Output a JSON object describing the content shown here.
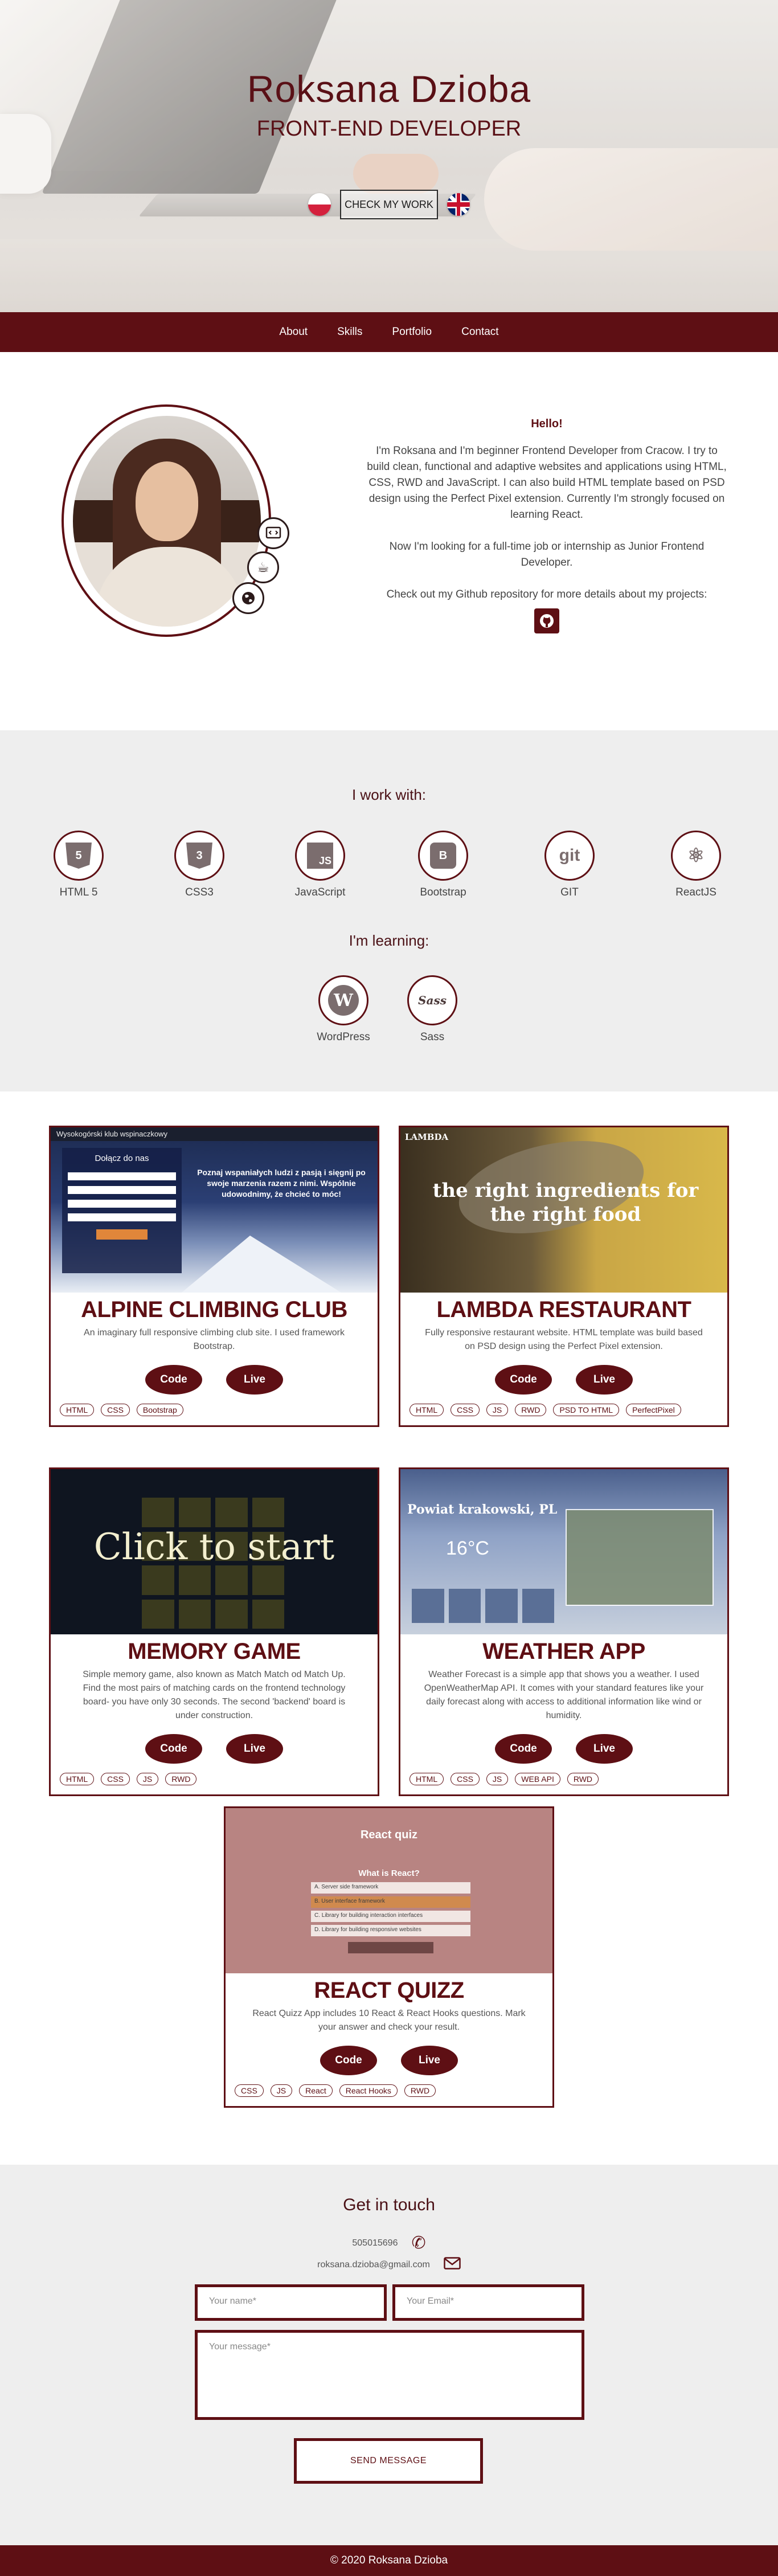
{
  "header": {
    "name": "Roksana Dzioba",
    "role": "FRONT-END DEVELOPER",
    "cta": "CHECK MY WORK"
  },
  "nav": {
    "items": [
      "About",
      "Skills",
      "Portfolio",
      "Contact"
    ]
  },
  "about": {
    "greeting": "Hello!",
    "p1": "I'm Roksana and I'm beginner Frontend Developer from Cracow. I try to build clean, functional and adaptive websites and applications using HTML, CSS, RWD and JavaScript. I can also build HTML template based on PSD design using the Perfect Pixel extension. Currently I'm strongly focused on learning React.",
    "p2": "Now I'm looking for a full-time job or internship as Junior Frontend Developer.",
    "p3": "Check out my Github repository for more details about my projects:"
  },
  "skills": {
    "working_title": "I work with:",
    "working": [
      {
        "label": "HTML 5",
        "icon": "html5-icon",
        "glyph": "5"
      },
      {
        "label": "CSS3",
        "icon": "css3-icon",
        "glyph": "3"
      },
      {
        "label": "JavaScript",
        "icon": "javascript-icon",
        "glyph": "JS"
      },
      {
        "label": "Bootstrap",
        "icon": "bootstrap-icon",
        "glyph": "B"
      },
      {
        "label": "GIT",
        "icon": "git-icon",
        "glyph": "git"
      },
      {
        "label": "ReactJS",
        "icon": "react-icon",
        "glyph": "⚛"
      }
    ],
    "learning_title": "I'm learning:",
    "learning": [
      {
        "label": "WordPress",
        "icon": "wordpress-icon",
        "glyph": "W"
      },
      {
        "label": "Sass",
        "icon": "sass-icon",
        "glyph": "Sass"
      }
    ]
  },
  "projects": [
    {
      "title": "ALPINE CLIMBING CLUB",
      "desc": "An imaginary full responsive climbing club site. I used framework Bootstrap.",
      "code": "Code",
      "live": "Live",
      "tags": [
        "HTML",
        "CSS",
        "Bootstrap"
      ],
      "thumb": {
        "site": "Wysokogórski klub wspinaczkowy",
        "join": "Dołącz do nas",
        "quote": "Poznaj wspaniałych ludzi z pasją i sięgnij po swoje marzenia razem z nimi. Wspólnie udowodnimy, że chcieć to móc!"
      }
    },
    {
      "title": "LAMBDA RESTAURANT",
      "desc": "Fully responsive restaurant website. HTML template was build based on PSD design using the Perfect Pixel extension.",
      "code": "Code",
      "live": "Live",
      "tags": [
        "HTML",
        "CSS",
        "JS",
        "RWD",
        "PSD TO HTML",
        "PerfectPixel"
      ],
      "thumb": {
        "brand": "LAMBDA",
        "headline": "the right ingredients for the right food"
      }
    },
    {
      "title": "MEMORY GAME",
      "desc": "Simple memory game, also known as Match Match od Match Up. Find the most pairs of matching cards on the frontend technology board- you have only 30 seconds. The second 'backend' board is under construction.",
      "code": "Code",
      "live": "Live",
      "tags": [
        "HTML",
        "CSS",
        "JS",
        "RWD"
      ],
      "thumb": {
        "overlay": "Click to start"
      }
    },
    {
      "title": "WEATHER APP",
      "desc": "Weather Forecast is a simple app that shows you a weather. I used OpenWeatherMap API. It comes with your standard features like your daily forecast along with access to additional information like wind or humidity.",
      "code": "Code",
      "live": "Live",
      "tags": [
        "HTML",
        "CSS",
        "JS",
        "WEB API",
        "RWD"
      ],
      "thumb": {
        "city": "Powiat krakowski, PL",
        "temp": "16°C"
      }
    },
    {
      "title": "REACT QUIZZ",
      "desc": "React Quizz App includes 10 React & React Hooks questions. Mark your answer and check your result.",
      "code": "Code",
      "live": "Live",
      "tags": [
        "CSS",
        "JS",
        "React",
        "React Hooks",
        "RWD"
      ],
      "thumb": {
        "heading": "React quiz",
        "question": "What is React?",
        "options": [
          "A. Server side framework",
          "B. User interface framework",
          "C. Library for building interaction interfaces",
          "D. Library for building responsive websites"
        ]
      }
    }
  ],
  "contact": {
    "title": "Get in touch",
    "phone": "505015696",
    "email": "roksana.dzioba@gmail.com",
    "name_ph": "Your name*",
    "email_ph": "Your Email*",
    "message_ph": "Your message*",
    "send": "SEND MESSAGE"
  },
  "footer": {
    "text": "© 2020 Roksana Dzioba"
  },
  "colors": {
    "accent": "#5e0f14",
    "section_bg": "#eeeeee"
  }
}
